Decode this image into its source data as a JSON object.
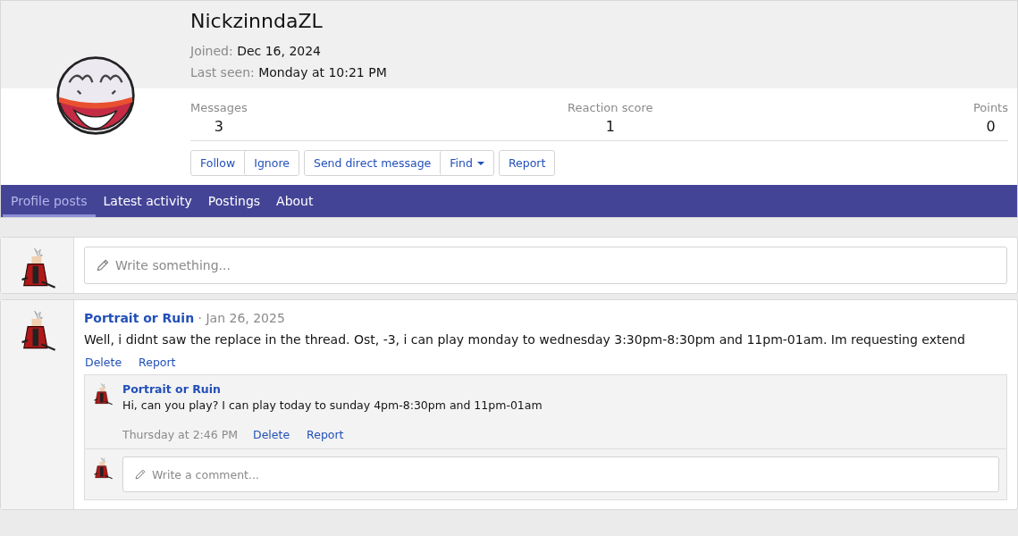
{
  "profile": {
    "username": "NickzinndaZL",
    "joined_label": "Joined:",
    "joined": "Dec 16, 2024",
    "last_seen_label": "Last seen:",
    "last_seen": "Monday at 10:21 PM",
    "stats": [
      {
        "label": "Messages",
        "value": "3"
      },
      {
        "label": "Reaction score",
        "value": "1"
      },
      {
        "label": "Points",
        "value": "0"
      }
    ],
    "button_groups": [
      [
        {
          "label": "Follow",
          "has_menu": false
        },
        {
          "label": "Ignore",
          "has_menu": false
        }
      ],
      [
        {
          "label": "Send direct message",
          "has_menu": false
        },
        {
          "label": "Find",
          "has_menu": true
        }
      ],
      [
        {
          "label": "Report",
          "has_menu": false
        }
      ]
    ]
  },
  "tabs": [
    {
      "label": "Profile posts",
      "selected": true
    },
    {
      "label": "Latest activity",
      "selected": false
    },
    {
      "label": "Postings",
      "selected": false
    },
    {
      "label": "About",
      "selected": false
    }
  ],
  "status_box": {
    "placeholder": "Write something..."
  },
  "posts": [
    {
      "author": "Portrait or Ruin",
      "date": "· Jan 26, 2025",
      "text": "Well, i didnt saw the replace in the thread. Ost, -3, i can play monday to wednesday 3:30pm-8:30pm and 11pm-01am. Im requesting extend",
      "actions": [
        "Delete",
        "Report"
      ],
      "comments": [
        {
          "author": "Portrait or Ruin",
          "text": "Hi, can you play? I can play today to sunday 4pm-8:30pm and 11pm-01am",
          "time": "Thursday at 2:46 PM",
          "actions": [
            "Delete",
            "Report"
          ]
        }
      ],
      "comment_box": {
        "placeholder": "Write a comment..."
      }
    }
  ]
}
